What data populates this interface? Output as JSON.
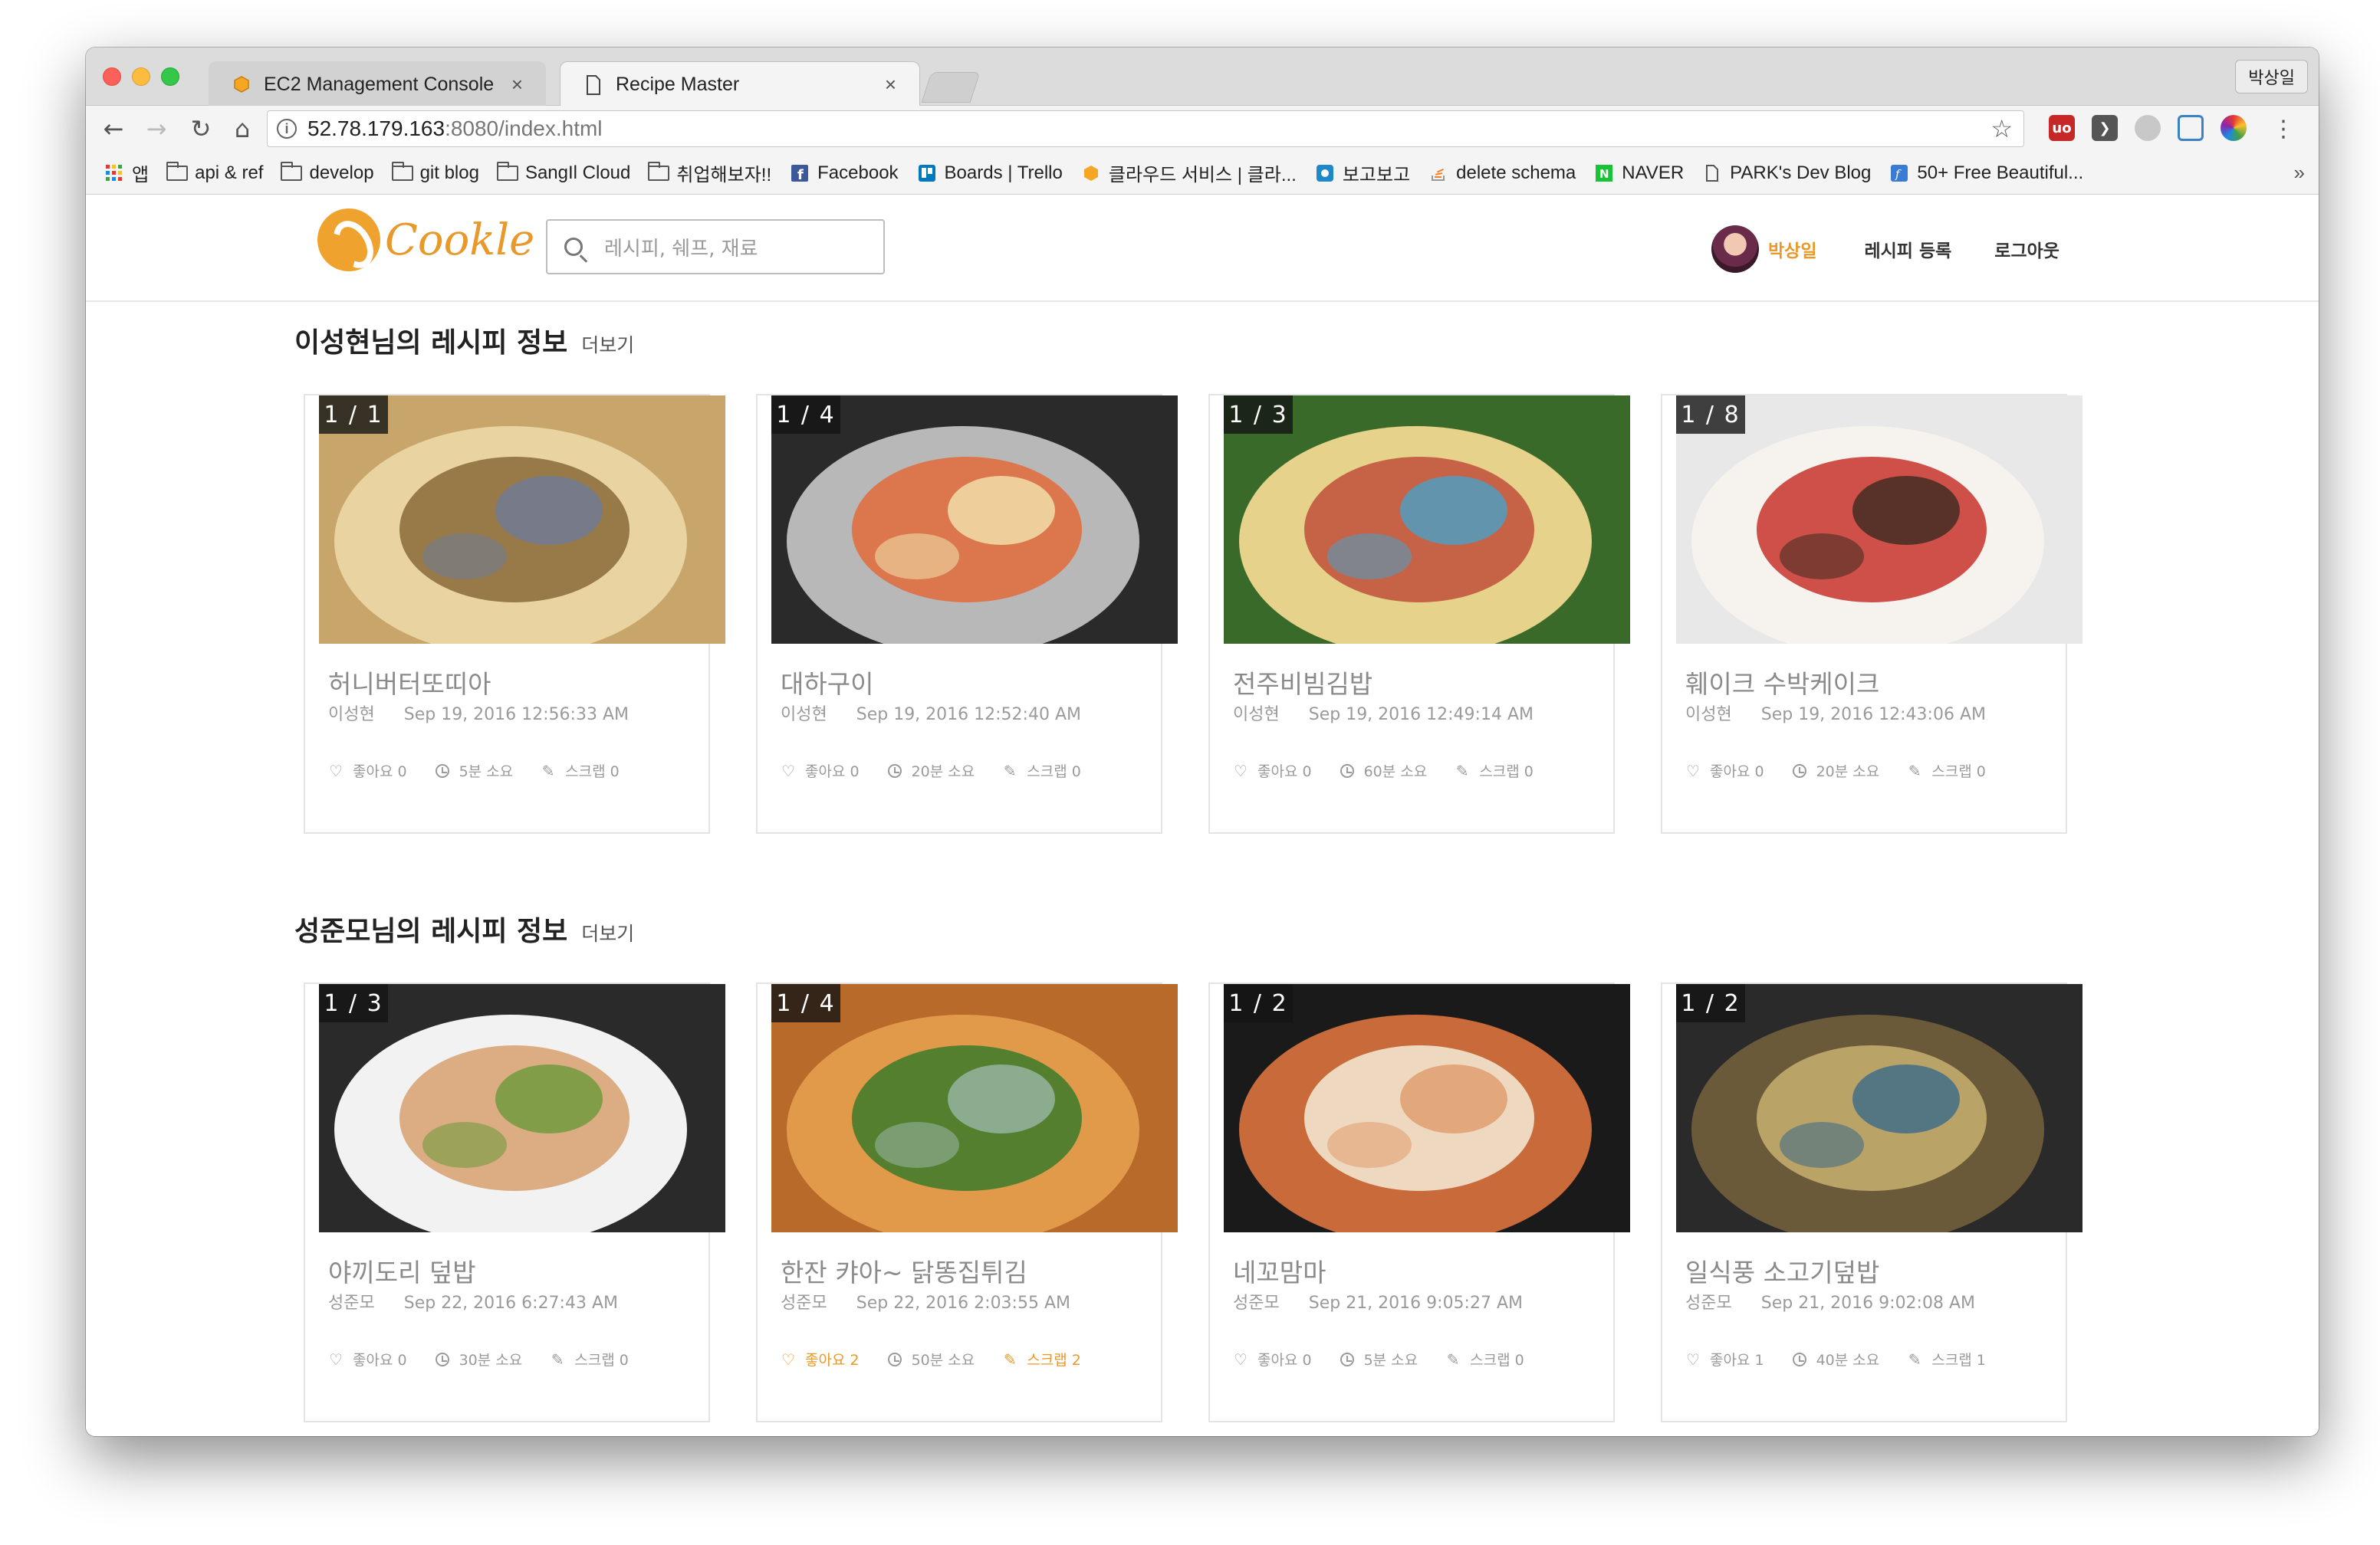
{
  "browser": {
    "tabs": [
      {
        "title": "EC2 Management Console",
        "close": "×"
      },
      {
        "title": "Recipe Master",
        "close": "×"
      }
    ],
    "profile": "박상일",
    "address": {
      "host": "52.78.179.163",
      "path": ":8080/index.html"
    },
    "bookmarks": [
      {
        "label": "앱",
        "icon": "apps-grid-icon"
      },
      {
        "label": "api & ref",
        "icon": "folder-icon"
      },
      {
        "label": "develop",
        "icon": "folder-icon"
      },
      {
        "label": "git blog",
        "icon": "folder-icon"
      },
      {
        "label": "SangIl Cloud",
        "icon": "folder-icon"
      },
      {
        "label": "취업해보자!!",
        "icon": "folder-icon"
      },
      {
        "label": "Facebook",
        "icon": "facebook-icon"
      },
      {
        "label": "Boards | Trello",
        "icon": "trello-icon"
      },
      {
        "label": "클라우드 서비스 | 클라...",
        "icon": "aws-icon"
      },
      {
        "label": "보고보고",
        "icon": "bogo-icon"
      },
      {
        "label": "delete schema",
        "icon": "stackoverflow-icon"
      },
      {
        "label": "NAVER",
        "icon": "naver-icon"
      },
      {
        "label": "PARK's Dev Blog",
        "icon": "page-icon"
      },
      {
        "label": "50+ Free Beautiful...",
        "icon": "bookmark-f-icon"
      }
    ],
    "more": "»"
  },
  "site": {
    "logo": "Cookle",
    "search_placeholder": "레시피, 쉐프, 재료",
    "user": "박상일",
    "nav": [
      "레시피 등록",
      "로그아웃"
    ]
  },
  "sections": [
    {
      "title": "이성현님의 레시피 정보",
      "more": "더보기",
      "cards": [
        {
          "badge": "1 / 1",
          "title": "허니버터또띠아",
          "author": "이성현",
          "date": "Sep 19, 2016 12:56:33 AM",
          "likes": "좋아요 0",
          "time": "5분 소요",
          "scrap": "스크랩 0",
          "liked": false,
          "scrapped": false
        },
        {
          "badge": "1 / 4",
          "title": "대하구이",
          "author": "이성현",
          "date": "Sep 19, 2016 12:52:40 AM",
          "likes": "좋아요 0",
          "time": "20분 소요",
          "scrap": "스크랩 0",
          "liked": false,
          "scrapped": false
        },
        {
          "badge": "1 / 3",
          "title": "전주비빔김밥",
          "author": "이성현",
          "date": "Sep 19, 2016 12:49:14 AM",
          "likes": "좋아요 0",
          "time": "60분 소요",
          "scrap": "스크랩 0",
          "liked": false,
          "scrapped": false
        },
        {
          "badge": "1 / 8",
          "title": "훼이크 수박케이크",
          "author": "이성현",
          "date": "Sep 19, 2016 12:43:06 AM",
          "likes": "좋아요 0",
          "time": "20분 소요",
          "scrap": "스크랩 0",
          "liked": false,
          "scrapped": false
        }
      ]
    },
    {
      "title": "성준모님의 레시피 정보",
      "more": "더보기",
      "cards": [
        {
          "badge": "1 / 3",
          "title": "야끼도리 덮밥",
          "author": "성준모",
          "date": "Sep 22, 2016 6:27:43 AM",
          "likes": "좋아요 0",
          "time": "30분 소요",
          "scrap": "스크랩 0",
          "liked": false,
          "scrapped": false
        },
        {
          "badge": "1 / 4",
          "title": "한잔 캬아~ 닭똥집튀김",
          "author": "성준모",
          "date": "Sep 22, 2016 2:03:55 AM",
          "likes": "좋아요 2",
          "time": "50분 소요",
          "scrap": "스크랩 2",
          "liked": true,
          "scrapped": true
        },
        {
          "badge": "1 / 2",
          "title": "네꼬맘마",
          "author": "성준모",
          "date": "Sep 21, 2016 9:05:27 AM",
          "likes": "좋아요 0",
          "time": "5분 소요",
          "scrap": "스크랩 0",
          "liked": false,
          "scrapped": false
        },
        {
          "badge": "1 / 2",
          "title": "일식풍 소고기덮밥",
          "author": "성준모",
          "date": "Sep 21, 2016 9:02:08 AM",
          "likes": "좋아요 1",
          "time": "40분 소요",
          "scrap": "스크랩 1",
          "liked": false,
          "scrapped": false
        }
      ]
    }
  ],
  "colors": {
    "accent": "#e9982a",
    "muted": "#9a9a9a"
  }
}
